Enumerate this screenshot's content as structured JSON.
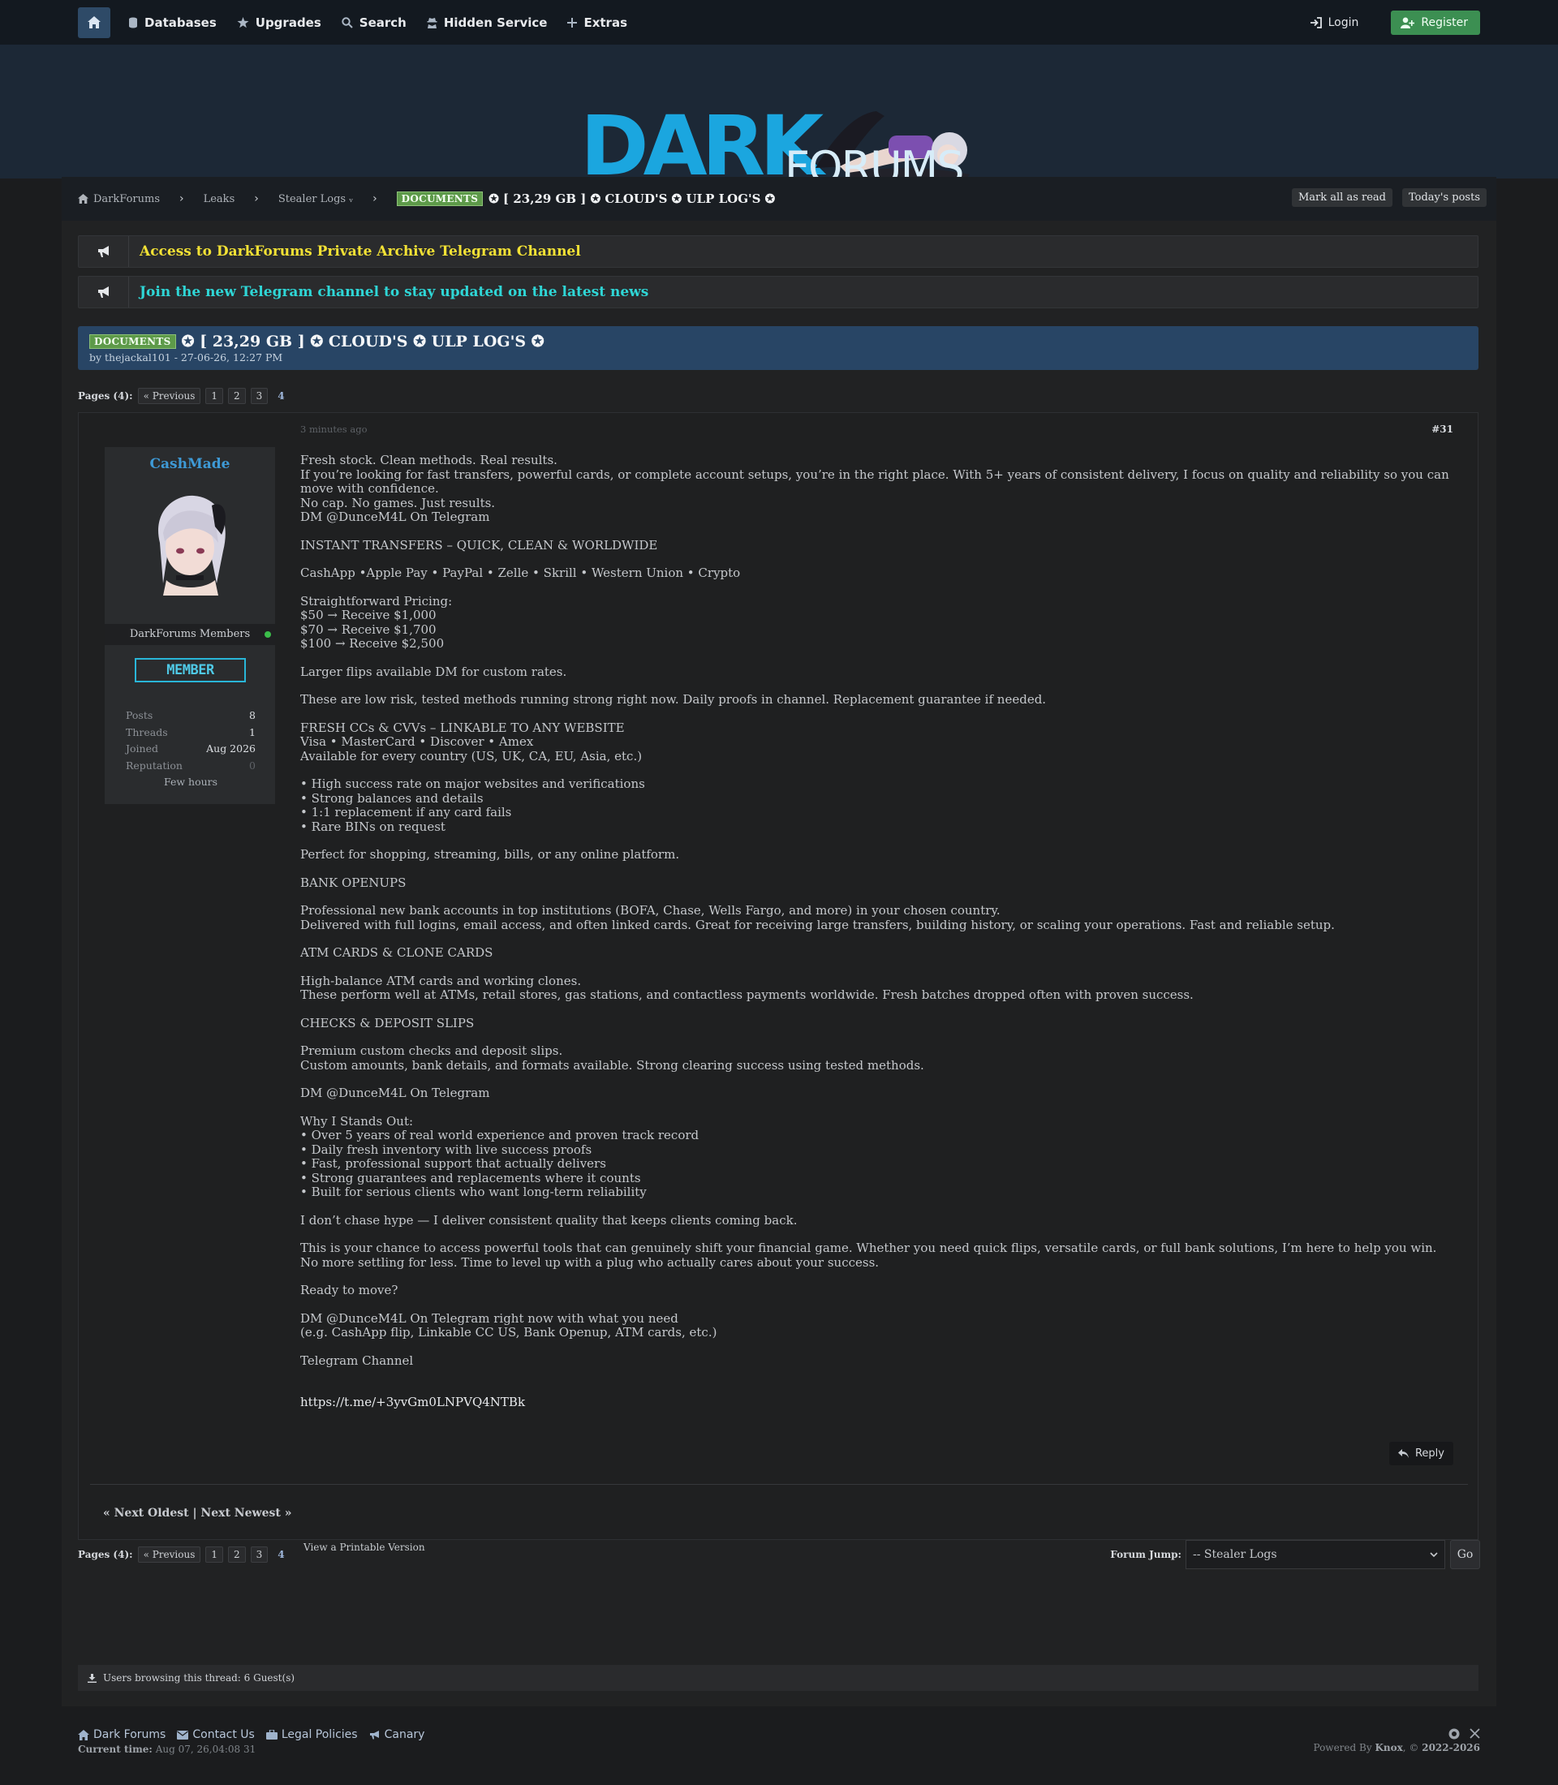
{
  "nav": {
    "items": [
      "Databases",
      "Upgrades",
      "Search",
      "Hidden Service",
      "Extras"
    ],
    "login": "Login",
    "register": "Register"
  },
  "logo": {
    "dark": "DARK",
    "forums": "FORUMS"
  },
  "breadcrumb": {
    "items": [
      "DarkForums",
      "Leaks",
      "Stealer Logs ᵥ"
    ],
    "tag": "DOCUMENTS",
    "current": "✪ [ 23,29 GB ] ✪ CLOUD'S ✪ ULP LOG'S ✪",
    "mark_read": "Mark all as read",
    "todays_posts": "Today's posts"
  },
  "announcements": [
    {
      "text": "Access to DarkForums Private Archive Telegram Channel",
      "color": "#f2e135"
    },
    {
      "text": "Join the new Telegram channel to stay updated on the latest news",
      "color": "#2fd6d6"
    }
  ],
  "thread": {
    "tag": "DOCUMENTS",
    "title": "✪ [ 23,29 GB ] ✪ CLOUD'S ✪ ULP LOG'S ✪",
    "byline": "by thejackal101 - 27-06-26, 12:27 PM"
  },
  "pagination": {
    "label": "Pages (4):",
    "previous": "« Previous",
    "pages": [
      "1",
      "2",
      "3"
    ],
    "current": "4"
  },
  "post": {
    "time": "3 minutes ago",
    "number": "#31",
    "user": {
      "name": "CashMade",
      "group": "DarkForums Members",
      "badge": "MEMBER",
      "stats": [
        {
          "label": "Posts",
          "value": "8"
        },
        {
          "label": "Threads",
          "value": "1"
        },
        {
          "label": "Joined",
          "value": "Aug 2026"
        },
        {
          "label": "Reputation",
          "value": "0"
        }
      ],
      "online_for": "Few hours"
    },
    "paragraphs": [
      [
        "Fresh stock. Clean methods. Real results.",
        "If you’re looking for fast transfers, powerful cards, or complete account setups, you’re in the right place. With 5+ years of consistent delivery, I focus on quality and reliability so you can move with confidence.",
        "No cap. No games. Just results.",
        "DM @DunceM4L On Telegram"
      ],
      [
        "INSTANT TRANSFERS – QUICK, CLEAN & WORLDWIDE"
      ],
      [
        "CashApp •Apple Pay • PayPal • Zelle • Skrill • Western Union • Crypto"
      ],
      [
        "Straightforward Pricing:",
        "$50 → Receive $1,000",
        "$70 → Receive $1,700",
        "$100 → Receive $2,500"
      ],
      [
        "Larger flips available DM for custom rates."
      ],
      [
        "These are low risk, tested methods running strong right now. Daily proofs in channel. Replacement guarantee if needed."
      ],
      [
        "FRESH CCs & CVVs – LINKABLE TO ANY WEBSITE",
        "Visa • MasterCard • Discover • Amex",
        "Available for every country (US, UK, CA, EU, Asia, etc.)"
      ],
      [
        "• High success rate on major websites and verifications",
        "• Strong balances and details",
        "• 1:1 replacement if any card fails",
        "• Rare BINs on request"
      ],
      [
        "Perfect for shopping, streaming, bills, or any online platform."
      ],
      [
        "BANK OPENUPS"
      ],
      [
        "Professional new bank accounts in top institutions (BOFA, Chase, Wells Fargo, and more) in your chosen country.",
        "Delivered with full logins, email access, and often linked cards. Great for receiving large transfers, building history, or scaling your operations. Fast and reliable setup."
      ],
      [
        "ATM CARDS & CLONE CARDS"
      ],
      [
        "High-balance ATM cards and working clones.",
        "These perform well at ATMs, retail stores, gas stations, and contactless payments worldwide. Fresh batches dropped often with proven success."
      ],
      [
        "CHECKS & DEPOSIT SLIPS"
      ],
      [
        "Premium custom checks and deposit slips.",
        "Custom amounts, bank details, and formats available. Strong clearing success using tested methods."
      ],
      [
        "DM @DunceM4L On Telegram"
      ],
      [
        "Why I Stands Out:",
        "• Over 5 years of real world experience and proven track record",
        "• Daily fresh inventory with live success proofs",
        "• Fast, professional support that actually delivers",
        "• Strong guarantees and replacements where it counts",
        "• Built for serious clients who want long-term reliability"
      ],
      [
        "I don’t chase hype — I deliver consistent quality that keeps clients coming back."
      ],
      [
        "This is your chance to access powerful tools that can genuinely shift your financial game. Whether you need quick flips, versatile cards, or full bank solutions, I’m here to help you win.",
        "No more settling for less. Time to level up with a plug who actually cares about your success."
      ],
      [
        "Ready to move?"
      ],
      [
        "DM @DunceM4L On Telegram right now with what you need",
        "(e.g. CashApp flip, Linkable CC US, Bank Openup, ATM cards, etc.)"
      ],
      [
        "Telegram Channel"
      ]
    ],
    "link": "https://t.me/+3yvGm0LNPVQ4NTBk",
    "reply": "Reply"
  },
  "thread_nav": "« Next Oldest | Next Newest »",
  "printable": "View a Printable Version",
  "forum_jump": {
    "label": "Forum Jump:",
    "selected": "-- Stealer Logs",
    "go": "Go"
  },
  "browsing": "Users browsing this thread: 6 Guest(s)",
  "footer": {
    "links": [
      "Dark Forums",
      "Contact Us",
      "Legal Policies",
      "Canary"
    ],
    "time_label": "Current time:",
    "time_value": "Aug 07, 26,04:08 31",
    "powered_prefix": "Powered By",
    "powered_name": "Knox",
    "copyright_prefix": ", ©",
    "copyright_years": "2022-2026"
  }
}
